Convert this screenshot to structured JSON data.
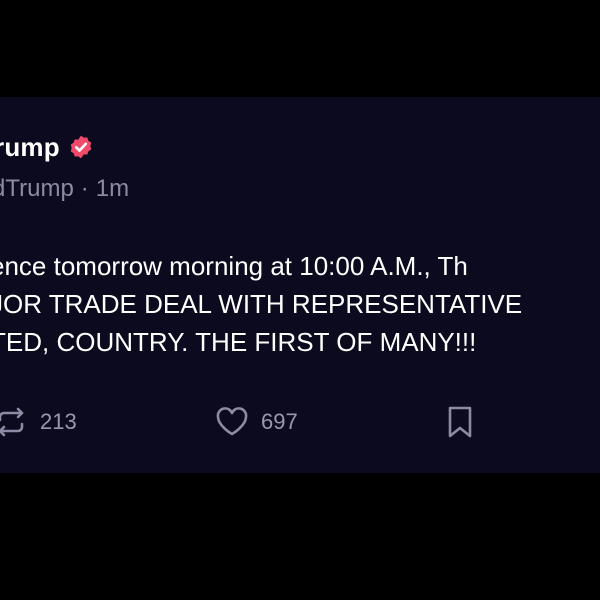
{
  "post": {
    "author_name": "rump",
    "handle": "dTrump",
    "time_separator": "·",
    "time_ago": "1m",
    "lines": [
      "ence tomorrow morning at 10:00 A.M., Th",
      "JOR TRADE DEAL WITH REPRESENTATIVE",
      "TED, COUNTRY. THE FIRST OF MANY!!!"
    ]
  },
  "actions": {
    "reposts": "213",
    "likes": "697"
  },
  "icons": {
    "verified": "verified-badge-icon",
    "repost": "repost-icon",
    "like": "heart-icon",
    "bookmark": "bookmark-icon"
  },
  "colors": {
    "background": "#000000",
    "card": "#0b0a1f",
    "text": "#ffffff",
    "muted": "#8d8ba3",
    "verified": "#f04a6a"
  }
}
